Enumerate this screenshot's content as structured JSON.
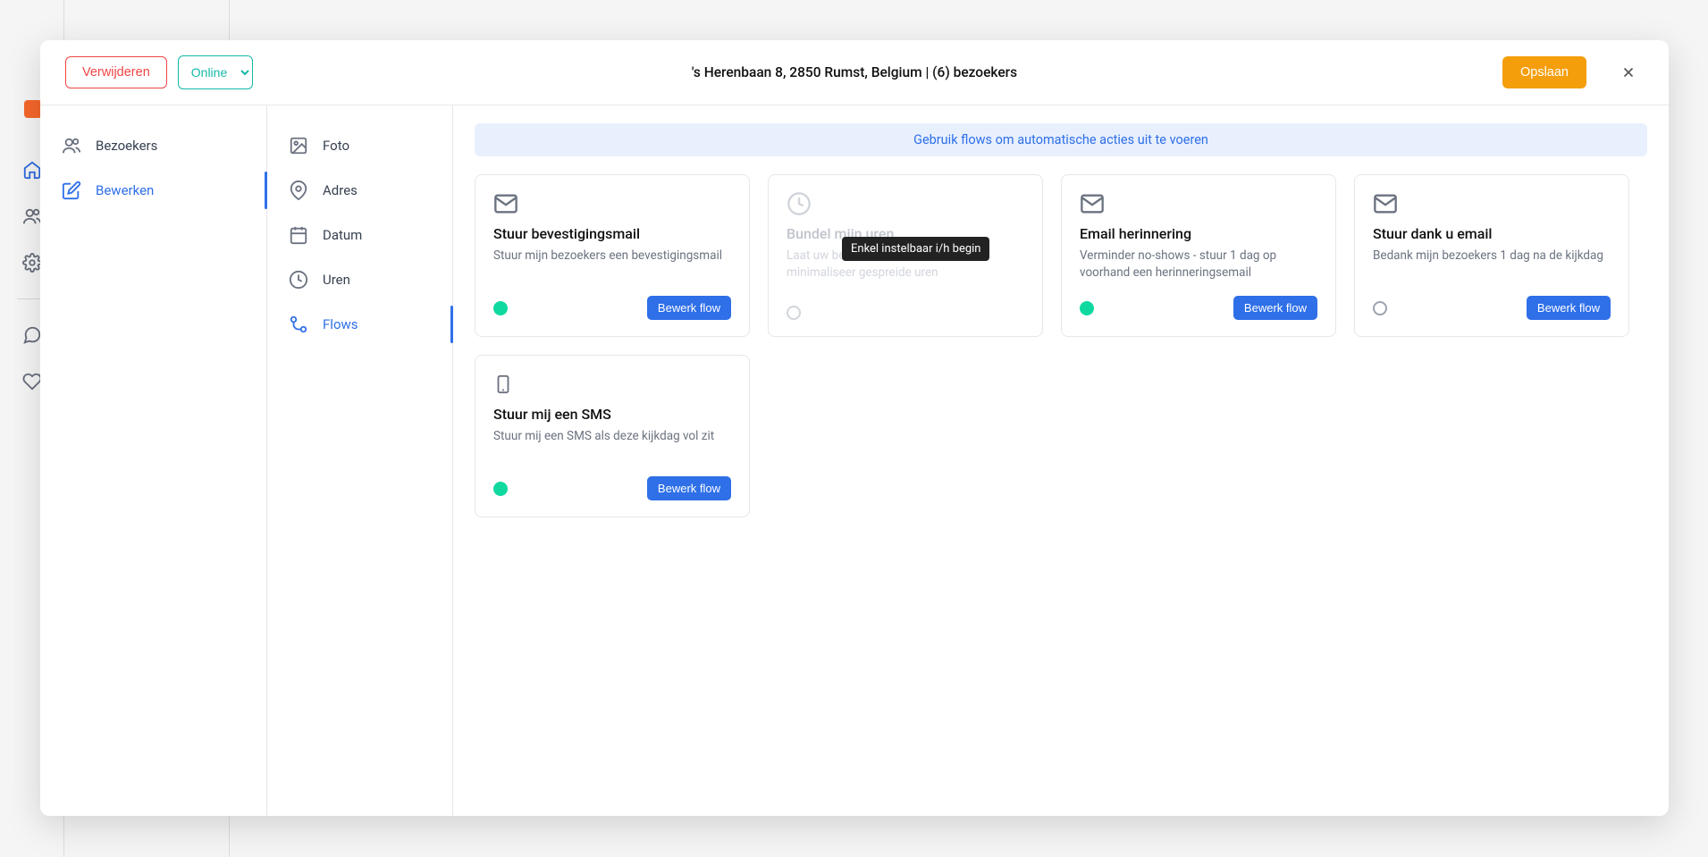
{
  "app_sidebar": {
    "items": [
      "home",
      "contacts",
      "settings",
      "chat",
      "heart"
    ]
  },
  "header": {
    "delete_label": "Verwijderen",
    "status_value": "Online",
    "title": "'s Herenbaan 8, 2850 Rumst, Belgium | (6) bezoekers",
    "save_label": "Opslaan"
  },
  "left_nav": {
    "items": [
      {
        "label": "Bezoekers",
        "icon": "users"
      },
      {
        "label": "Bewerken",
        "icon": "edit",
        "active": true
      }
    ]
  },
  "mid_nav": {
    "items": [
      {
        "label": "Foto",
        "icon": "photo"
      },
      {
        "label": "Adres",
        "icon": "location"
      },
      {
        "label": "Datum",
        "icon": "calendar"
      },
      {
        "label": "Uren",
        "icon": "clock"
      },
      {
        "label": "Flows",
        "icon": "flows",
        "active": true
      }
    ]
  },
  "banner": "Gebruik flows om automatische acties uit te voeren",
  "tooltip": "Enkel instelbaar i/h begin",
  "cards": [
    {
      "icon": "mail",
      "title": "Stuur bevestigingsmail",
      "desc": "Stuur mijn bezoekers een bevestigingsmail",
      "status": "on",
      "edit_label": "Bewerk flow",
      "disabled": false
    },
    {
      "icon": "clock",
      "title": "Bundel mijn uren",
      "desc": "Laat uw bezoekers samen komen, minimaliseer gespreide uren",
      "status": "disabled",
      "disabled": true
    },
    {
      "icon": "mail",
      "title": "Email herinnering",
      "desc": "Verminder no-shows - stuur 1 dag op voorhand een herinneringsemail",
      "status": "on",
      "edit_label": "Bewerk flow",
      "disabled": false
    },
    {
      "icon": "mail",
      "title": "Stuur dank u email",
      "desc": "Bedank mijn bezoekers 1 dag na de kijkdag",
      "status": "off",
      "edit_label": "Bewerk flow",
      "disabled": false
    },
    {
      "icon": "phone",
      "title": "Stuur mij een SMS",
      "desc": "Stuur mij een SMS als deze kijkdag vol zit",
      "status": "on",
      "edit_label": "Bewerk flow",
      "disabled": false
    }
  ]
}
